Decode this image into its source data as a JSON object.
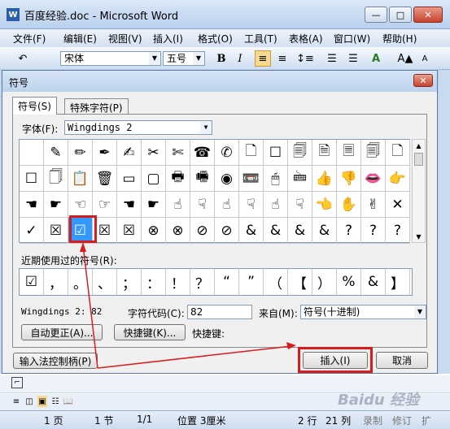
{
  "window": {
    "title": "百度经验.doc - Microsoft Word",
    "min": "—",
    "max": "□",
    "close": "✕"
  },
  "menu": [
    "文件(F)",
    "编辑(E)",
    "视图(V)",
    "插入(I)",
    "格式(O)",
    "工具(T)",
    "表格(A)",
    "窗口(W)",
    "帮助(H)"
  ],
  "toolbar": {
    "font": "宋体",
    "size": "五号",
    "bold": "B",
    "italic": "I"
  },
  "dialog": {
    "title": "符号",
    "close": "✕",
    "tabs": [
      "符号(S)",
      "特殊字符(P)"
    ],
    "font_label": "字体(F):",
    "font_value": "Wingdings 2",
    "recent_label": "近期使用过的符号(R):",
    "code_name": "Wingdings 2: 82",
    "char_code_label": "字符代码(C):",
    "char_code_value": "82",
    "from_label": "来自(M):",
    "from_value": "符号(十进制)",
    "autocorrect": "自动更正(A)...",
    "shortcut_key": "快捷键(K)...",
    "shortcut_label": "快捷键:",
    "ime_button": "输入法控制柄(P)",
    "insert": "插入(I)",
    "cancel": "取消"
  },
  "symbols": [
    " ",
    "✎",
    "✏",
    "✒",
    "✍",
    "✂",
    "✄",
    "☎",
    "✆",
    "🗋",
    "☐",
    "🗐",
    "🗎",
    "🗏",
    "🗐",
    "🗋",
    "☐",
    "🗍",
    "📋",
    "🗑",
    "▭",
    "▢",
    "🖶",
    "🖷",
    "◉",
    "📼",
    "🖱",
    "🖮",
    "👍",
    "👎",
    "👄",
    "👉",
    "☚",
    "☛",
    "☜",
    "☞",
    "☚",
    "☛",
    "☝",
    "☟",
    "☝",
    "☟",
    "☝",
    "☟",
    "👈",
    "✋",
    "✌",
    "✕",
    "✓",
    "☒",
    "☑",
    "☒",
    "☒",
    "⊗",
    "⊗",
    "⊘",
    "⊘",
    "&",
    "&",
    "&",
    "&",
    "?",
    "?",
    "?"
  ],
  "recent": [
    "☑",
    "，",
    "。",
    "、",
    "；",
    "：",
    "！",
    "？",
    "“",
    "”",
    "（",
    "【",
    "）",
    "%",
    "&",
    "】"
  ],
  "status": {
    "page": "1 页",
    "section": "1 节",
    "pages": "1/1",
    "position": "位置 3厘米",
    "line": "2 行",
    "col": "21 列",
    "record": "录制",
    "revise": "修订",
    "ext": "扩"
  },
  "watermark": "Baidu 经验"
}
